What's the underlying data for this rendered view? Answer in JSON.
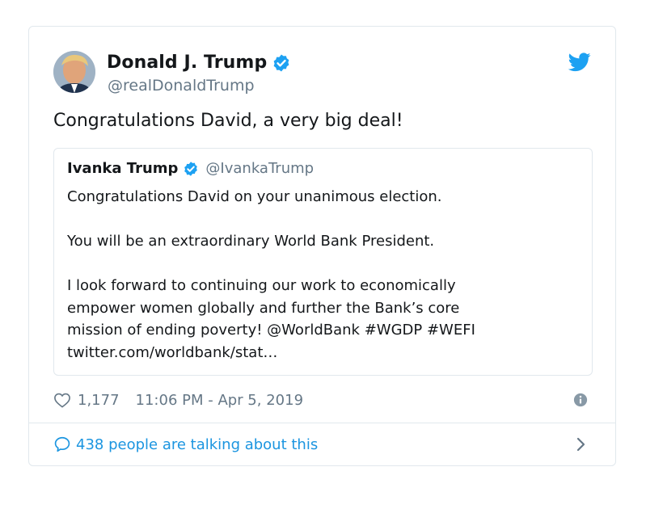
{
  "tweet": {
    "author_name": "Donald J. Trump",
    "author_handle": "@realDonaldTrump",
    "text": "Congratulations David, a very big deal!",
    "likes": "1,177",
    "timestamp": "11:06 PM - Apr 5, 2019",
    "conversation": "438 people are talking about this"
  },
  "quote": {
    "author_name": "Ivanka Trump",
    "author_handle": "@IvankaTrump",
    "line1": "Congratulations David on your unanimous election.",
    "line2": "You will be an extraordinary World Bank President.",
    "line3": "I look forward to continuing our work to economically",
    "line4": "empower women globally and further the Bank’s core",
    "line5": "mission of ending poverty! @WorldBank #WGDP #WEFI",
    "line6": "twitter.com/worldbank/stat…"
  },
  "colors": {
    "accent": "#1da1f2",
    "link": "#1b95e0",
    "muted": "#657786",
    "border": "#e1e8ed"
  },
  "icons": [
    "twitter-bird-icon",
    "verified-badge-icon",
    "heart-icon",
    "info-icon",
    "comment-bubble-icon",
    "chevron-right-icon"
  ]
}
